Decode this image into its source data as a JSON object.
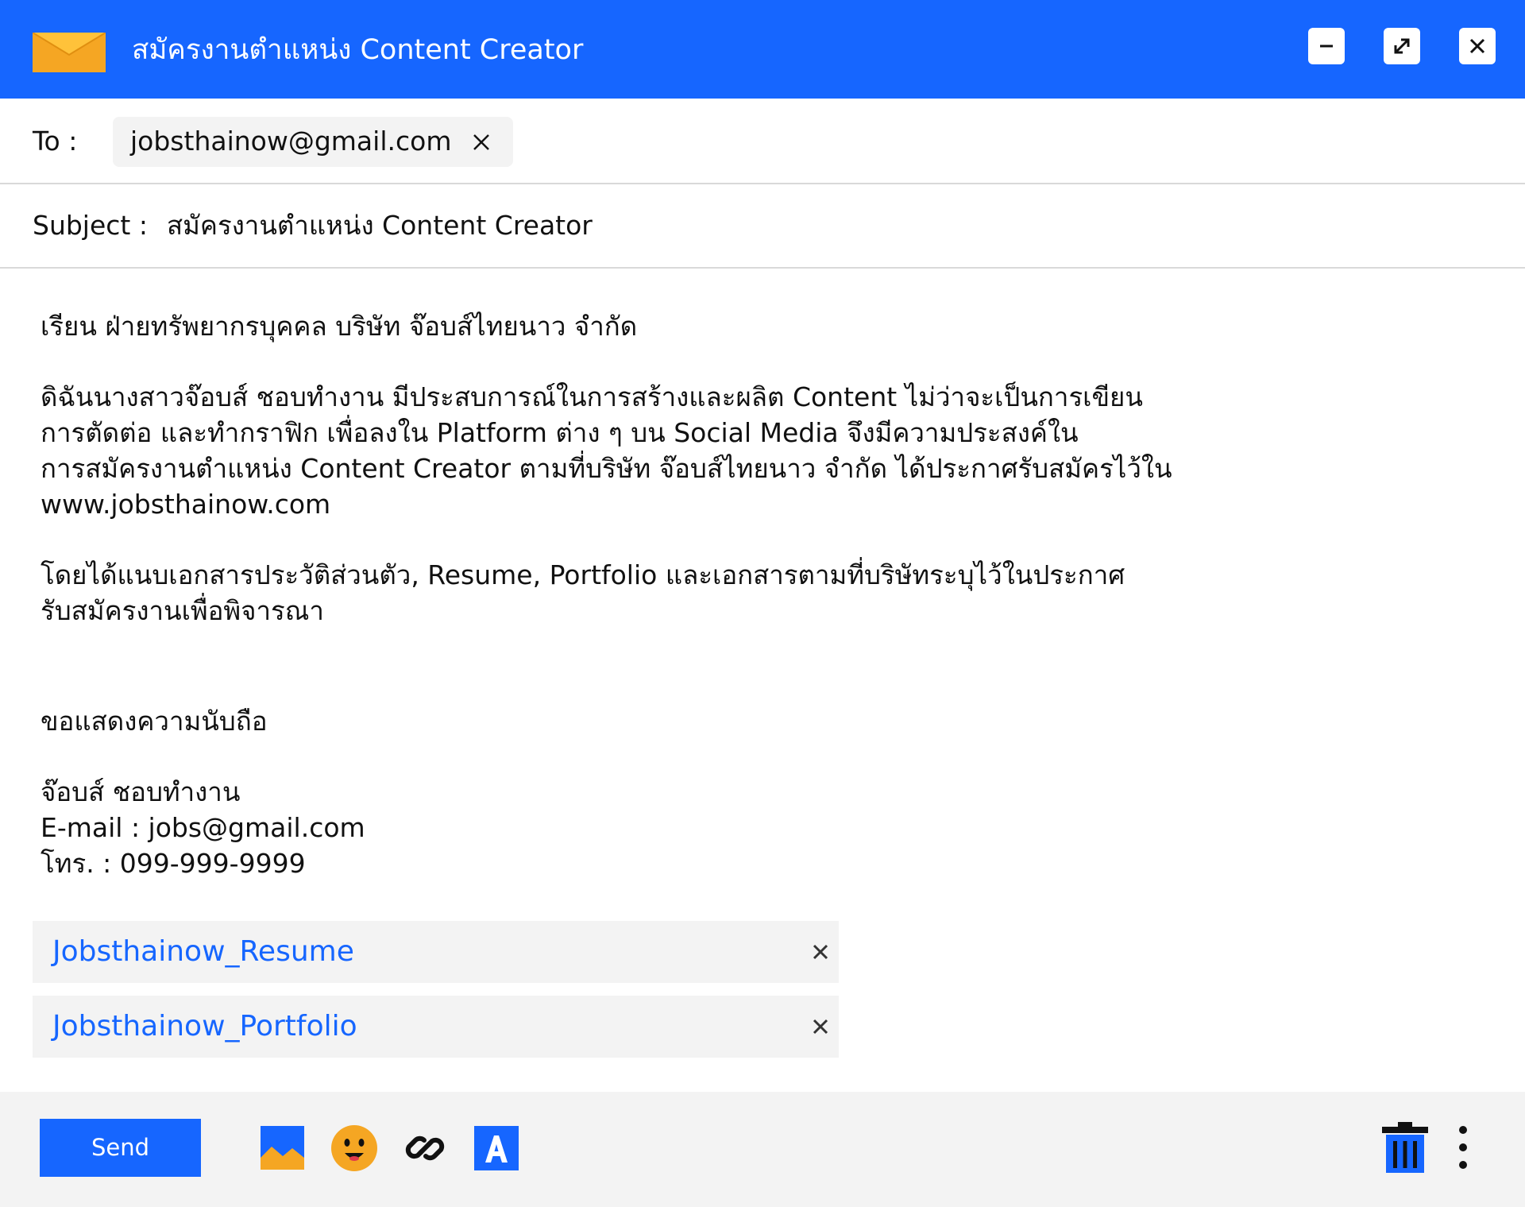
{
  "window": {
    "title": "สมัครงานตำแหน่ง Content Creator",
    "accent_color": "#1666ff",
    "envelope_color": "#f5a623",
    "controls": {
      "minimize_icon": "minimize-icon",
      "maximize_icon": "maximize-icon",
      "close_icon": "close-icon"
    }
  },
  "to": {
    "label": "To :",
    "recipient": "jobsthainow@gmail.com",
    "remove_icon": "close-icon"
  },
  "subject": {
    "label": "Subject :",
    "value": "สมัครงานตำแหน่ง Content Creator"
  },
  "body": {
    "greeting": "เรียน ฝ่ายทรัพยากรบุคคล บริษัท จ๊อบส์ไทยนาว จำกัด",
    "paragraph1": [
      "ดิฉันนางสาวจ๊อบส์ ชอบทำงาน มีประสบการณ์ในการสร้างและผลิต Content ไม่ว่าจะเป็นการเขียน",
      "การตัดต่อ และทำกราฟิก เพื่อลงใน Platform ต่าง ๆ บน Social Media จึงมีความประสงค์ใน",
      "การสมัครงานตำแหน่ง Content Creator ตามที่บริษัท จ๊อบส์ไทยนาว จำกัด ได้ประกาศรับสมัครไว้ใน",
      "www.jobsthainow.com"
    ],
    "paragraph2": [
      "โดยได้แนบเอกสารประวัติส่วนตัว, Resume, Portfolio และเอกสารตามที่บริษัทระบุไว้ในประกาศ",
      "รับสมัครงานเพื่อพิจารณา"
    ],
    "closing": "ขอแสดงความนับถือ",
    "signature": [
      "จ๊อบส์ ชอบทำงาน",
      "E-mail : jobs@gmail.com",
      "โทร. : 099-999-9999"
    ]
  },
  "attachments": [
    {
      "name": "Jobsthainow_Resume",
      "remove_icon": "close-icon"
    },
    {
      "name": "Jobsthainow_Portfolio",
      "remove_icon": "close-icon"
    }
  ],
  "toolbar": {
    "send_label": "Send",
    "icons": [
      "image-icon",
      "emoji-icon",
      "link-icon",
      "text-format-icon",
      "trash-icon",
      "more-vertical-icon"
    ],
    "emoji_color": "#f5a623",
    "trash_color": "#1666ff"
  }
}
